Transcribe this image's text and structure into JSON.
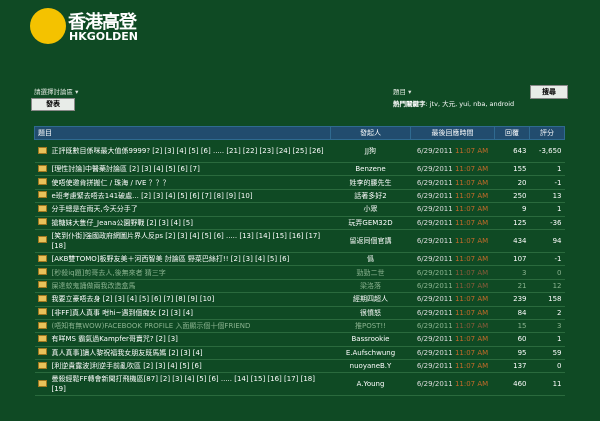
{
  "logo": {
    "cn": "香港高登",
    "en": "HKGOLDEN"
  },
  "forum_select": "請選擇討論區 ▾",
  "post_button": "發表",
  "search_label": "題目 ▾",
  "search_button": "搜尋",
  "hot_keywords_label": "熱門關鍵字",
  "hot_keywords": ": jtv, 大元, yui, nba, android",
  "table_headers": {
    "title": "題目",
    "author": "發起人",
    "last_reply": "最後回應時間",
    "replies": "回覆",
    "rating": "評分"
  },
  "rows": [
    {
      "title": "正評既數目係咪最大值係9999?",
      "pages": "[2] [3] [4] [5] [6] ..... [21] [22] [23] [24] [25] [26]",
      "author": "JJ狗",
      "date": "6/29/2011",
      "time": "11:07 AM",
      "replies": "643",
      "rating": "-3,650",
      "tall": true
    },
    {
      "title": "[理性討論]中醫藥討論區",
      "pages": "[2] [3] [4] [5] [6] [7]",
      "author": "Benzene",
      "date": "6/29/2011",
      "time": "11:07 AM",
      "replies": "155",
      "rating": "1"
    },
    {
      "title": "使唔使邀肯拼搬仁 / 珠海 / IVE ？？？",
      "pages": "",
      "author": "姓李的腰先生",
      "date": "6/29/2011",
      "time": "11:07 AM",
      "replies": "20",
      "rating": "-1"
    },
    {
      "title": "e班考慮緊去唔去141破處...",
      "pages": "[2] [3] [4] [5] [6] [7] [8] [9] [10]",
      "author": "話著多好2",
      "date": "6/29/2011",
      "time": "11:07 AM",
      "replies": "250",
      "rating": "13"
    },
    {
      "title": "分手總是在雨天,今天分手了",
      "pages": "",
      "author": "小眾",
      "date": "6/29/2011",
      "time": "11:07 AM",
      "replies": "9",
      "rating": "1"
    },
    {
      "title": "搶糖妹大隻仔_Jeana公園野戰",
      "pages": "[2] [3] [4] [5]",
      "author": "玩弄GEM32D",
      "date": "6/29/2011",
      "time": "11:07 AM",
      "replies": "125",
      "rating": "-36"
    },
    {
      "title": "[笑到仆街]強國政府網圖片界人反ps",
      "pages": "[2] [3] [4] [5] [6] ..... [13] [14] [15] [16] [17] [18]",
      "author": "留返同個官講",
      "date": "6/29/2011",
      "time": "11:07 AM",
      "replies": "434",
      "rating": "94",
      "tall": true
    },
    {
      "title": "[AKB雙TOMO]板野友美＋河西智美 討論區 野菜巴絲打!!",
      "pages": "[2] [3] [4] [5] [6]",
      "author": "僞",
      "date": "6/29/2011",
      "time": "11:07 AM",
      "replies": "107",
      "rating": "-1"
    },
    {
      "title": "[秒殺iq題]剪哥去人,後無來者 猜三字",
      "pages": "",
      "author": "勁勁二世",
      "date": "6/29/2011",
      "time": "11:07 AM",
      "replies": "3",
      "rating": "0",
      "grey": true
    },
    {
      "title": "屎達蚊鬼誦做兩我改造盒馬",
      "pages": "",
      "author": "梁洛落",
      "date": "6/29/2011",
      "time": "11:07 AM",
      "replies": "21",
      "rating": "12",
      "grey": true
    },
    {
      "title": "我要立豪唔去身",
      "pages": "[2] [3] [4] [5] [6] [7] [8] [9] [10]",
      "author": "經期四超人",
      "date": "6/29/2011",
      "time": "11:07 AM",
      "replies": "239",
      "rating": "158"
    },
    {
      "title": "[非FF]真人真事 咁hi~遇到個痴女",
      "pages": "[2] [3] [4]",
      "author": "很憤怒",
      "date": "6/29/2011",
      "time": "11:07 AM",
      "replies": "84",
      "rating": "2"
    },
    {
      "title": "(唔知有無WOW)FACEBOOK PROFILE 入面顯示個十個FRIEND",
      "pages": "",
      "author": "推POST!!",
      "date": "6/29/2011",
      "time": "11:07 AM",
      "replies": "15",
      "rating": "3",
      "grey": true
    },
    {
      "title": "有咩MS 霸氣過Kampfer哥賣咒?",
      "pages": "[2] [3]",
      "author": "Bassrookie",
      "date": "6/29/2011",
      "time": "11:07 AM",
      "replies": "60",
      "rating": "1"
    },
    {
      "title": "真人真事]讀人黎祝福我女朋友既馬媽",
      "pages": "[2] [3] [4]",
      "author": "E.Aufschwung",
      "date": "6/29/2011",
      "time": "11:07 AM",
      "replies": "95",
      "rating": "59"
    },
    {
      "title": "[利逆貴露波]利逆手前亂吹區",
      "pages": "[2] [3] [4] [5] [6]",
      "author": "nuoyaneB.Y",
      "date": "6/29/2011",
      "time": "11:07 AM",
      "replies": "137",
      "rating": "0"
    },
    {
      "title": "曼殺經鬆FF轉會新聞打飛機區[87]",
      "pages": "[2] [3] [4] [5] [6] ..... [14] [15] [16] [17] [18] [19]",
      "author": "A.Young",
      "date": "6/29/2011",
      "time": "11:07 AM",
      "replies": "460",
      "rating": "11",
      "tall": true
    }
  ]
}
